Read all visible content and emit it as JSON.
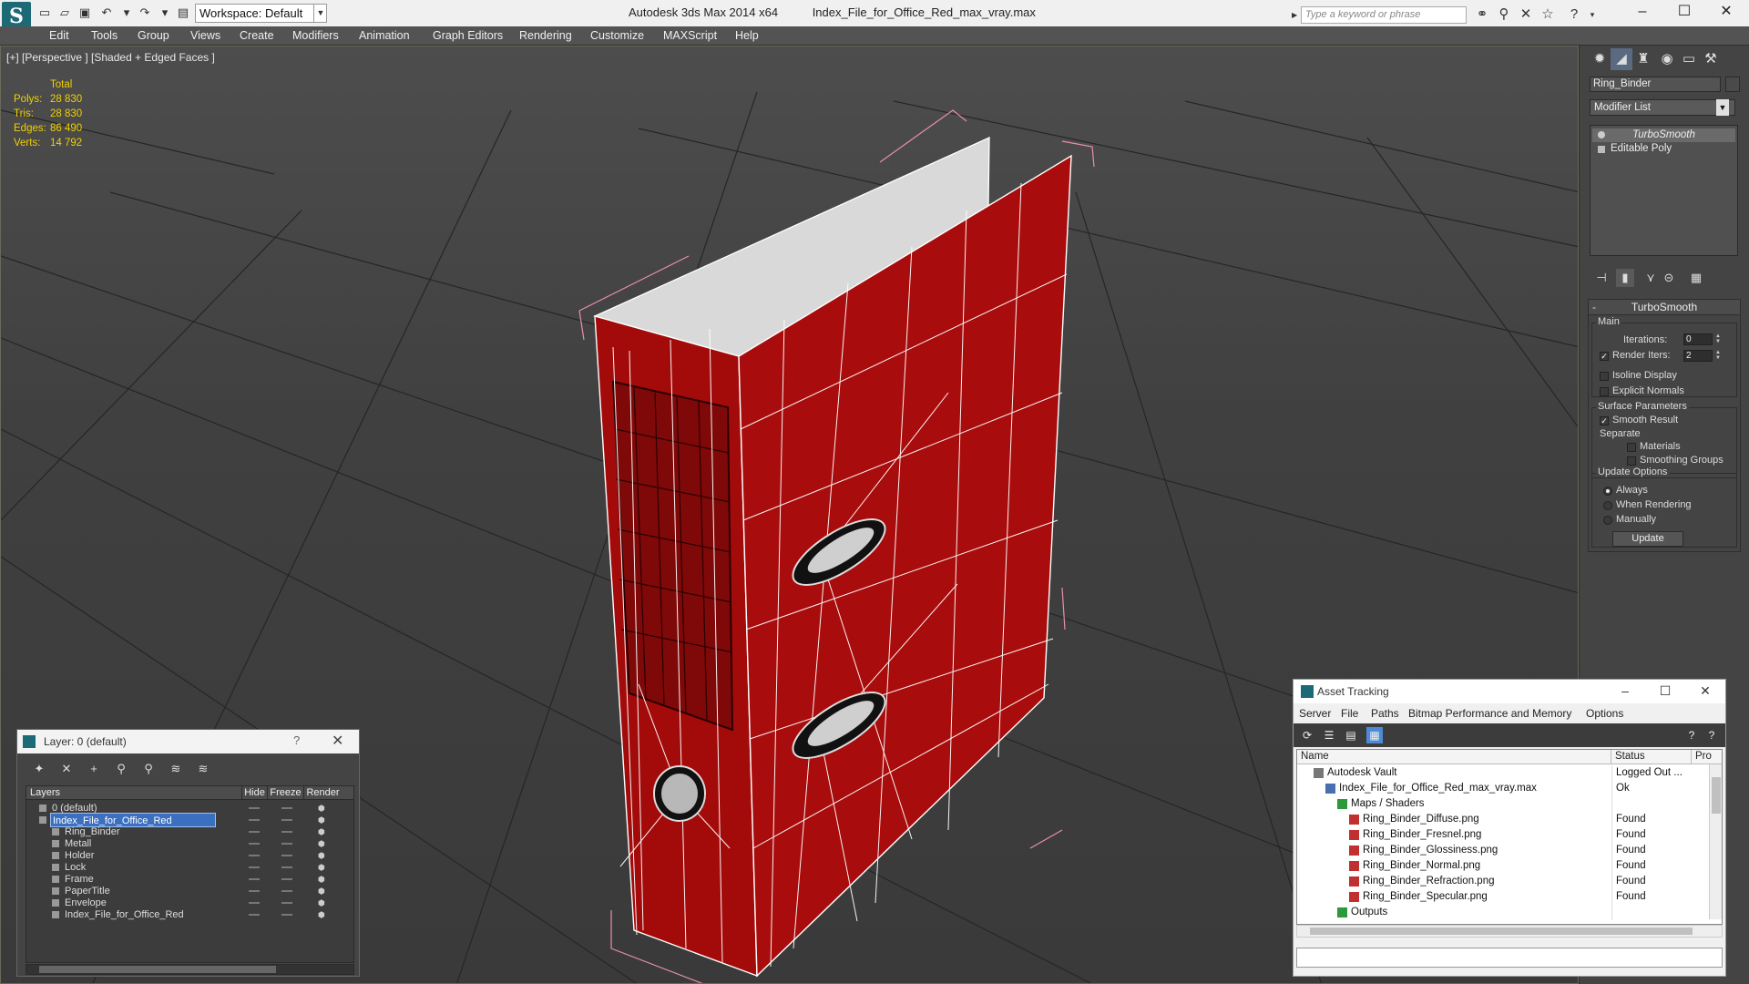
{
  "app": {
    "name": "Autodesk 3ds Max  2014 x64",
    "file": "Index_File_for_Office_Red_max_vray.max",
    "workspace": "Workspace: Default",
    "search_placeholder": "Type a keyword or phrase"
  },
  "menu": [
    "Edit",
    "Tools",
    "Group",
    "Views",
    "Create",
    "Modifiers",
    "Animation",
    "Graph Editors",
    "Rendering",
    "Customize",
    "MAXScript",
    "Help"
  ],
  "viewport": {
    "label": "[+] [Perspective ] [Shaded + Edged Faces ]",
    "stats": {
      "header": "Total",
      "rows": [
        {
          "label": "Polys:",
          "value": "28 830"
        },
        {
          "label": "Tris:",
          "value": "28 830"
        },
        {
          "label": "Edges:",
          "value": "86 490"
        },
        {
          "label": "Verts:",
          "value": "14 792"
        }
      ]
    }
  },
  "command_panel": {
    "object_name": "Ring_Binder",
    "modifier_list": "Modifier List",
    "stack": [
      "TurboSmooth",
      "Editable Poly"
    ],
    "turbosmooth": {
      "title": "TurboSmooth",
      "main_label": "Main",
      "iterations_label": "Iterations:",
      "iterations_value": "0",
      "render_iters_label": "Render Iters:",
      "render_iters_value": "2",
      "isoline": "Isoline Display",
      "explicit_normals": "Explicit Normals",
      "surface_params": "Surface Parameters",
      "smooth_result": "Smooth Result",
      "separate": "Separate",
      "materials": "Materials",
      "smoothing_groups": "Smoothing Groups",
      "update_options": "Update Options",
      "always": "Always",
      "when_rendering": "When Rendering",
      "manually": "Manually",
      "update_button": "Update"
    }
  },
  "layer_window": {
    "title": "Layer: 0 (default)",
    "help": "?",
    "columns": [
      "Layers",
      "Hide",
      "Freeze",
      "Render"
    ],
    "rows": [
      {
        "name": "0 (default)",
        "level": 0
      },
      {
        "name": "Index_File_for_Office_Red",
        "level": 0,
        "selected": true
      },
      {
        "name": "Ring_Binder",
        "level": 1
      },
      {
        "name": "Metall",
        "level": 1
      },
      {
        "name": "Holder",
        "level": 1
      },
      {
        "name": "Lock",
        "level": 1
      },
      {
        "name": "Frame",
        "level": 1
      },
      {
        "name": "PaperTitle",
        "level": 1
      },
      {
        "name": "Envelope",
        "level": 1
      },
      {
        "name": "Index_File_for_Office_Red",
        "level": 1
      }
    ]
  },
  "asset_tracking": {
    "title": "Asset Tracking",
    "menu": [
      "Server",
      "File",
      "Paths",
      "Bitmap Performance and Memory",
      "Options"
    ],
    "columns": [
      "Name",
      "Status",
      "Pro"
    ],
    "rows": [
      {
        "name": "Autodesk Vault",
        "status": "Logged Out ...",
        "level": 0
      },
      {
        "name": "Index_File_for_Office_Red_max_vray.max",
        "status": "Ok",
        "level": 1
      },
      {
        "name": "Maps / Shaders",
        "status": "",
        "level": 2
      },
      {
        "name": "Ring_Binder_Diffuse.png",
        "status": "Found",
        "level": 3
      },
      {
        "name": "Ring_Binder_Fresnel.png",
        "status": "Found",
        "level": 3
      },
      {
        "name": "Ring_Binder_Glossiness.png",
        "status": "Found",
        "level": 3
      },
      {
        "name": "Ring_Binder_Normal.png",
        "status": "Found",
        "level": 3
      },
      {
        "name": "Ring_Binder_Refraction.png",
        "status": "Found",
        "level": 3
      },
      {
        "name": "Ring_Binder_Specular.png",
        "status": "Found",
        "level": 3
      },
      {
        "name": "Outputs",
        "status": "",
        "level": 2
      }
    ]
  },
  "colors": {
    "accent": "#1c6a76",
    "binder_red": "#a80c0c",
    "stats_yellow": "#f0d000",
    "selection_blue": "#3b6fbf"
  }
}
